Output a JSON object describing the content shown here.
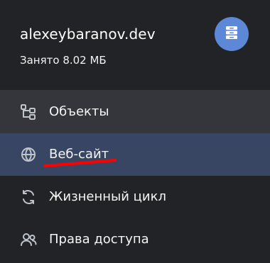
{
  "header": {
    "bucket_name": "alexeybaranov.dev",
    "usage_text": "Занято 8.02 МБ",
    "badge_icon": "archive-box-icon",
    "badge_color": "#5d88d8"
  },
  "nav": {
    "items": [
      {
        "label": "Объекты",
        "icon": "objects-tree-icon",
        "state": "hover"
      },
      {
        "label": "Веб-сайт",
        "icon": "globe-icon",
        "state": "active"
      },
      {
        "label": "Жизненный цикл",
        "icon": "refresh-cycle-icon",
        "state": "default"
      },
      {
        "label": "Права доступа",
        "icon": "users-icon",
        "state": "default"
      }
    ]
  },
  "colors": {
    "background": "#222326",
    "hover_background": "#34363b",
    "active_background": "#394663",
    "icon": "#bfc3ca",
    "annotation": "#ff0000"
  }
}
